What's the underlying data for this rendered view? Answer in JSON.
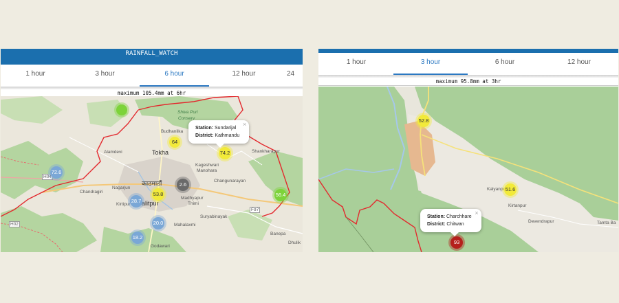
{
  "left": {
    "app_title": "RAINFALL_WATCH",
    "tabs": [
      "1 hour",
      "3 hour",
      "6 hour",
      "12 hour",
      "24"
    ],
    "active_tab": "6 hour",
    "max_line": "maximum 105.4mm at 6hr",
    "places": {
      "shivapuri": "Shiva Puri",
      "conservation": "Conserv",
      "budhanilkantha": "Budhanilka",
      "tokha": "Tokha",
      "shankharapur": "Shankharapur",
      "kageshwari": "Kageshwari",
      "manohara": "Manohara",
      "kathmandu_nep": "काठमाडौं",
      "nagarjun": "Nagarjun",
      "changunarayan": "Changunarayan",
      "chandragiri": "Chandragiri",
      "kirtipur": "Kirtipur",
      "lalitpur": "alitpur",
      "madhyapur": "Madhyapur",
      "thimi": "Thimi",
      "suryabinayak": "Suryabinayak",
      "mahalaxmi": "Mahalaxmi",
      "banepa": "Banepa",
      "dhulik": "Dhulik",
      "godawari": "Godawari",
      "h04": "H04",
      "h02": "H02",
      "f97": "F97",
      "alamdevi": "Alamdevi"
    },
    "markers": [
      {
        "label": "",
        "color": "#7dd33a"
      },
      {
        "label": "64",
        "color": "#f2ea3a"
      },
      {
        "label": "74.2",
        "color": "#f2ea3a"
      },
      {
        "label": "72.6",
        "color": "#7aa7d6"
      },
      {
        "label": "2.6",
        "color": "#6a6a6a"
      },
      {
        "label": "53.8",
        "color": "#f2ea3a"
      },
      {
        "label": "28.7",
        "color": "#7aa7d6"
      },
      {
        "label": "20.0",
        "color": "#7aa7d6"
      },
      {
        "label": "18.2",
        "color": "#7aa7d6"
      },
      {
        "label": "56.4",
        "color": "#7dd33a"
      }
    ],
    "popup": {
      "station_label": "Station:",
      "station": "Sundarijal",
      "district_label": "District:",
      "district": "Kathmandu",
      "close": "×"
    }
  },
  "right": {
    "tabs": [
      "1 hour",
      "3 hour",
      "6 hour",
      "12 hour"
    ],
    "active_tab": "3 hour",
    "max_line": "maximum 95.8mm at 3hr",
    "places": {
      "kalyanpur": "Kalyanpur",
      "kirtanpur": "Kirtanpur",
      "devendrapur": "Devendrapur",
      "tamata": "Tamta Ba"
    },
    "markers": [
      {
        "label": "52.8",
        "color": "#f2ea3a"
      },
      {
        "label": "51.6",
        "color": "#f2ea3a"
      },
      {
        "label": "93",
        "color": "#b5201c"
      }
    ],
    "popup": {
      "station_label": "Station:",
      "station": "Charchhare",
      "district_label": "District:",
      "district": "Chitwan",
      "close": "×"
    }
  }
}
